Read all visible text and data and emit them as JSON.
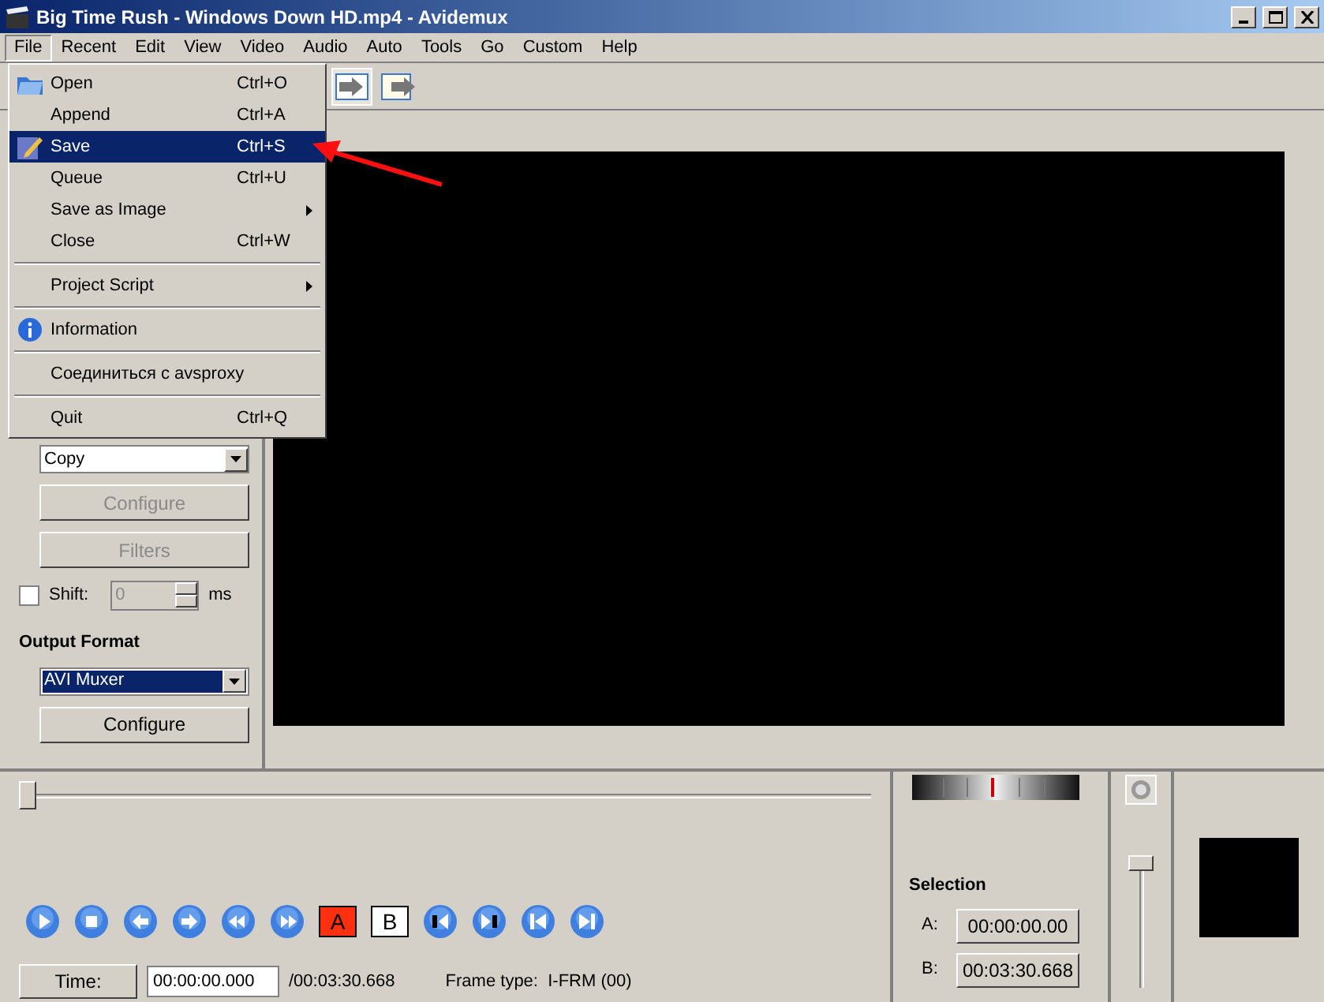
{
  "window": {
    "title": "Big Time Rush - Windows Down HD.mp4 - Avidemux"
  },
  "menu_bar": [
    {
      "label": "File",
      "selected": true
    },
    {
      "label": "Recent",
      "selected": false
    },
    {
      "label": "Edit",
      "selected": false
    },
    {
      "label": "View",
      "selected": false
    },
    {
      "label": "Video",
      "selected": false
    },
    {
      "label": "Audio",
      "selected": false
    },
    {
      "label": "Auto",
      "selected": false
    },
    {
      "label": "Tools",
      "selected": false
    },
    {
      "label": "Go",
      "selected": false
    },
    {
      "label": "Custom",
      "selected": false
    },
    {
      "label": "Help",
      "selected": false
    }
  ],
  "file_menu": [
    {
      "kind": "item",
      "label": "Open",
      "shortcut": "Ctrl+O",
      "selected": false
    },
    {
      "kind": "item",
      "label": "Append",
      "shortcut": "Ctrl+A",
      "selected": false
    },
    {
      "kind": "item",
      "label": "Save",
      "shortcut": "Ctrl+S",
      "selected": true
    },
    {
      "kind": "item",
      "label": "Queue",
      "shortcut": "Ctrl+U",
      "selected": false
    },
    {
      "kind": "submenu",
      "label": "Save as Image",
      "selected": false
    },
    {
      "kind": "item",
      "label": "Close",
      "shortcut": "Ctrl+W",
      "selected": false
    },
    {
      "kind": "separator"
    },
    {
      "kind": "submenu",
      "label": "Project Script",
      "selected": false
    },
    {
      "kind": "separator"
    },
    {
      "kind": "item",
      "label": "Information",
      "selected": false
    },
    {
      "kind": "separator"
    },
    {
      "kind": "item",
      "label": "Соединиться с avsproxy",
      "selected": false
    },
    {
      "kind": "separator"
    },
    {
      "kind": "item",
      "label": "Quit",
      "shortcut": "Ctrl+Q",
      "selected": false
    }
  ],
  "audio_output": {
    "value": "Copy",
    "configure": {
      "label": "Configure",
      "disabled": true
    },
    "filters": {
      "label": "Filters",
      "disabled": true
    },
    "shift": {
      "label": "Shift:",
      "checked": false,
      "value": "0",
      "unit": "ms",
      "disabled": true
    }
  },
  "output_format": {
    "title": "Output Format",
    "value": "AVI Muxer",
    "configure": {
      "label": "Configure",
      "disabled": false
    }
  },
  "timeline": {
    "level": 0
  },
  "transport": [
    {
      "kind": "play"
    },
    {
      "kind": "stop"
    },
    {
      "kind": "back"
    },
    {
      "kind": "forward"
    },
    {
      "kind": "rewind"
    },
    {
      "kind": "fastforward"
    },
    {
      "kind": "marker",
      "label": "A"
    },
    {
      "kind": "marker",
      "label": "B"
    },
    {
      "kind": "prev-segment"
    },
    {
      "kind": "next-segment"
    },
    {
      "kind": "first"
    },
    {
      "kind": "last"
    }
  ],
  "time": {
    "button": "Time:",
    "value": "00:00:00.000",
    "total": "/00:03:30.668",
    "frame_type": "Frame type:  I-FRM (00)"
  },
  "selection": {
    "title": "Selection",
    "rows": [
      {
        "label": "A:",
        "value": "00:00:00.00"
      },
      {
        "label": "B:",
        "value": "00:03:30.668"
      }
    ]
  },
  "volume": {
    "level": 1
  }
}
